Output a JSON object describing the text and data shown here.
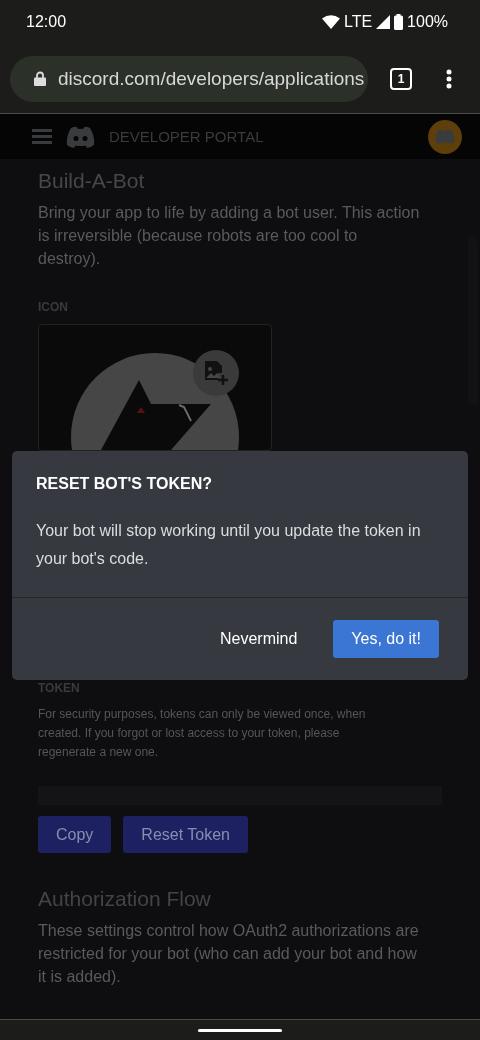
{
  "status_bar": {
    "time": "12:00",
    "network": "LTE",
    "battery": "100%"
  },
  "browser": {
    "url": "discord.com/developers/applications",
    "tab_count": "1"
  },
  "portal_header": {
    "title": "DEVELOPER PORTAL"
  },
  "bot_section": {
    "title": "Build-A-Bot",
    "description": "Bring your app to life by adding a bot user. This action is irreversible (because robots are too cool to destroy).",
    "icon_label": "ICON"
  },
  "token_section": {
    "label": "TOKEN",
    "description": "For security purposes, tokens can only be viewed once, when created. If you forgot or lost access to your token, please regenerate a new one.",
    "buttons": [
      "Copy",
      "Reset Token"
    ]
  },
  "auth_section": {
    "title": "Authorization Flow",
    "description": "These settings control how OAuth2 authorizations are restricted for your bot (who can add your bot and how it is added)."
  },
  "dialog": {
    "title": "RESET BOT'S TOKEN?",
    "message": "Your bot will stop working until you update the token in your bot's code.",
    "buttons": [
      {
        "label": "Nevermind",
        "kind": "link"
      },
      {
        "label": "Yes, do it!",
        "kind": "primary"
      }
    ]
  }
}
